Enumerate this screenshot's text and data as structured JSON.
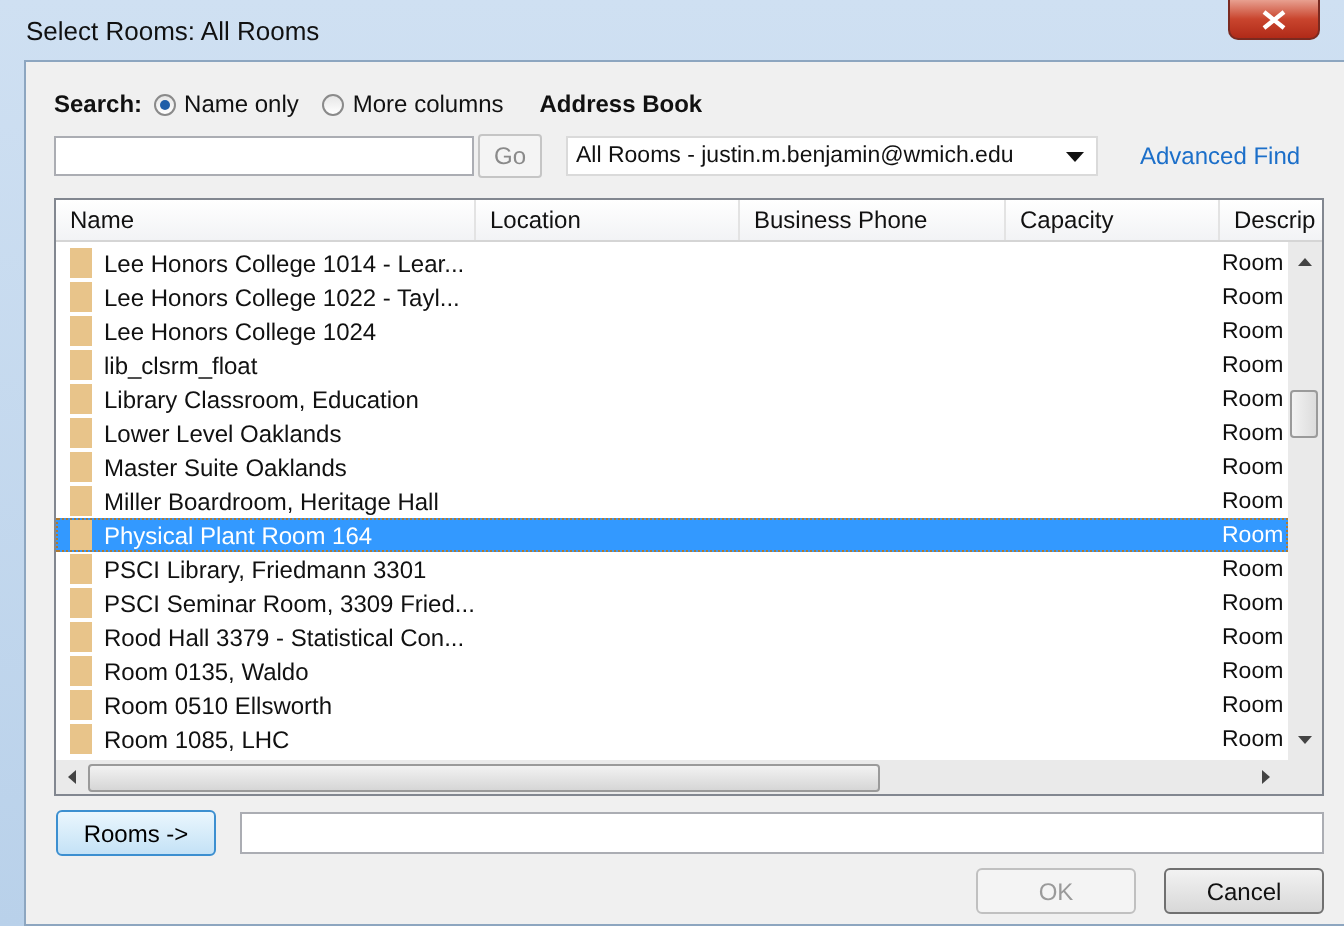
{
  "window": {
    "title": "Select Rooms: All Rooms"
  },
  "search": {
    "label": "Search:",
    "options": [
      {
        "label": "Name only",
        "selected": true
      },
      {
        "label": "More columns",
        "selected": false
      }
    ],
    "go_button": "Go"
  },
  "address_book": {
    "label": "Address Book",
    "value": "All Rooms - justin.m.benjamin@wmich.edu",
    "advanced_find": "Advanced Find"
  },
  "table": {
    "columns": [
      "Name",
      "Location",
      "Business Phone",
      "Capacity",
      "Descrip"
    ],
    "rows": [
      {
        "name": "Lee Honors College 1014 - Lear...",
        "description": "Room",
        "selected": false
      },
      {
        "name": "Lee Honors College 1022 - Tayl...",
        "description": "Room",
        "selected": false
      },
      {
        "name": "Lee Honors College 1024",
        "description": "Room",
        "selected": false
      },
      {
        "name": "lib_clsrm_float",
        "description": "Room",
        "selected": false
      },
      {
        "name": "Library Classroom, Education",
        "description": "Room",
        "selected": false
      },
      {
        "name": "Lower Level Oaklands",
        "description": "Room",
        "selected": false
      },
      {
        "name": "Master Suite Oaklands",
        "description": "Room",
        "selected": false
      },
      {
        "name": "Miller Boardroom, Heritage Hall",
        "description": "Room",
        "selected": false
      },
      {
        "name": "Physical Plant Room 164",
        "description": "Room",
        "selected": true
      },
      {
        "name": "PSCI Library, Friedmann 3301",
        "description": "Room",
        "selected": false
      },
      {
        "name": "PSCI Seminar Room, 3309 Fried...",
        "description": "Room",
        "selected": false
      },
      {
        "name": "Rood Hall 3379 - Statistical Con...",
        "description": "Room",
        "selected": false
      },
      {
        "name": "Room 0135, Waldo",
        "description": "Room",
        "selected": false
      },
      {
        "name": "Room 0510 Ellsworth",
        "description": "Room",
        "selected": false
      },
      {
        "name": "Room 1085, LHC",
        "description": "Room",
        "selected": false
      }
    ]
  },
  "rooms_button": "Rooms ->",
  "buttons": [
    {
      "label": "OK",
      "disabled": true
    },
    {
      "label": "Cancel",
      "disabled": false
    }
  ]
}
